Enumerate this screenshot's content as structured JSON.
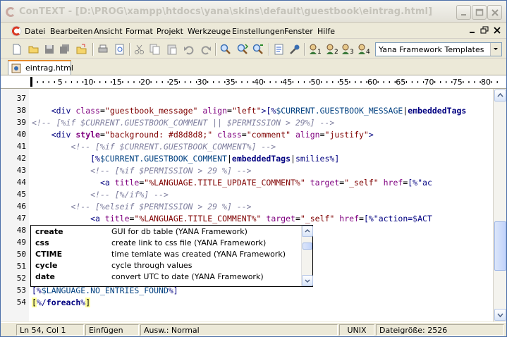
{
  "window": {
    "title": "ConTEXT - [D:\\PROG\\xampp\\htdocs\\yana\\skins\\default\\guestbook\\eintrag.html]"
  },
  "menu": {
    "items": [
      "Datei",
      "Bearbeiten",
      "Ansicht",
      "Format",
      "Projekt",
      "Werkzeuge",
      "Einstellungen",
      "Fenster",
      "Hilfe"
    ]
  },
  "toolbar": {
    "template_select_value": "Yana Framework Templates",
    "user_tool_labels": [
      "1",
      "2",
      "3",
      "4"
    ]
  },
  "tabs": [
    {
      "label": "eintrag.html"
    }
  ],
  "ruler": {
    "ticks": [
      "5",
      "10",
      "15",
      "20",
      "25",
      "30",
      "35",
      "40",
      "45",
      "50",
      "55",
      "60",
      "65",
      "70",
      "75",
      "80"
    ]
  },
  "editor": {
    "line_numbers": [
      "37",
      "38",
      "39",
      "40",
      "41",
      "42",
      "43",
      "44",
      "45",
      "46",
      "47",
      "48",
      "49",
      "50",
      "51",
      "52",
      "53",
      "54"
    ]
  },
  "autocomplete": {
    "items": [
      {
        "keyword": "create",
        "description": "GUI for db table (YANA Framework)"
      },
      {
        "keyword": "css",
        "description": "create link to css file (YANA Framework)"
      },
      {
        "keyword": "CTIME",
        "description": "time temlate was created (YANA Framework)"
      },
      {
        "keyword": "cycle",
        "description": "cycle through values"
      },
      {
        "keyword": "date",
        "description": "convert UTC to date (YANA Framework)"
      }
    ]
  },
  "status": {
    "position": "Ln 54, Col 1",
    "insert_mode": "Einfügen",
    "selection_mode": "Ausw.: Normal",
    "line_ending": "UNIX",
    "file_size": "Dateigröße: 2526"
  },
  "colors": {
    "tag": "#00007f",
    "attribute": "#7f007f",
    "attribute_value": "#7f0000",
    "comment": "#7f7f9f",
    "smarty_var": "#004080",
    "tab_accent": "#e68b2c"
  }
}
